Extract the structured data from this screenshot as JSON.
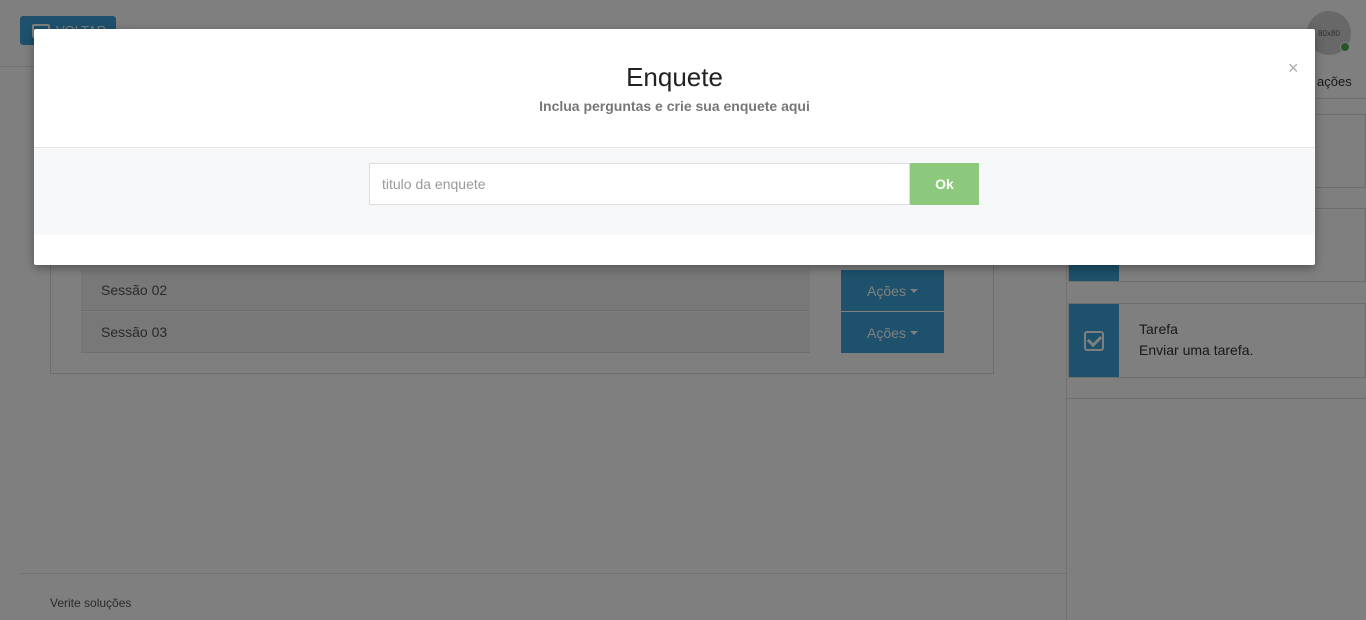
{
  "header": {
    "back_label": "VOLTAR",
    "avatar_text": "80x80"
  },
  "sidebar": {
    "tab_label": "ações",
    "cards": [
      {
        "title": "Tarefa",
        "description": "Enviar uma tarefa."
      }
    ]
  },
  "main": {
    "sessions": [
      {
        "label": "Sessão 02",
        "action_label": "Ações"
      },
      {
        "label": "Sessão 03",
        "action_label": "Ações"
      }
    ]
  },
  "footer": {
    "text": "Verite soluções"
  },
  "modal": {
    "title": "Enquete",
    "subtitle": "Inclua perguntas e crie sua enquete aqui",
    "close_symbol": "×",
    "input_placeholder": "titulo da enquete",
    "input_value": "",
    "ok_label": "Ok"
  },
  "colors": {
    "accent": "#3aa3d8",
    "ok_button": "#8cc97c",
    "online_status": "#4caf50"
  }
}
